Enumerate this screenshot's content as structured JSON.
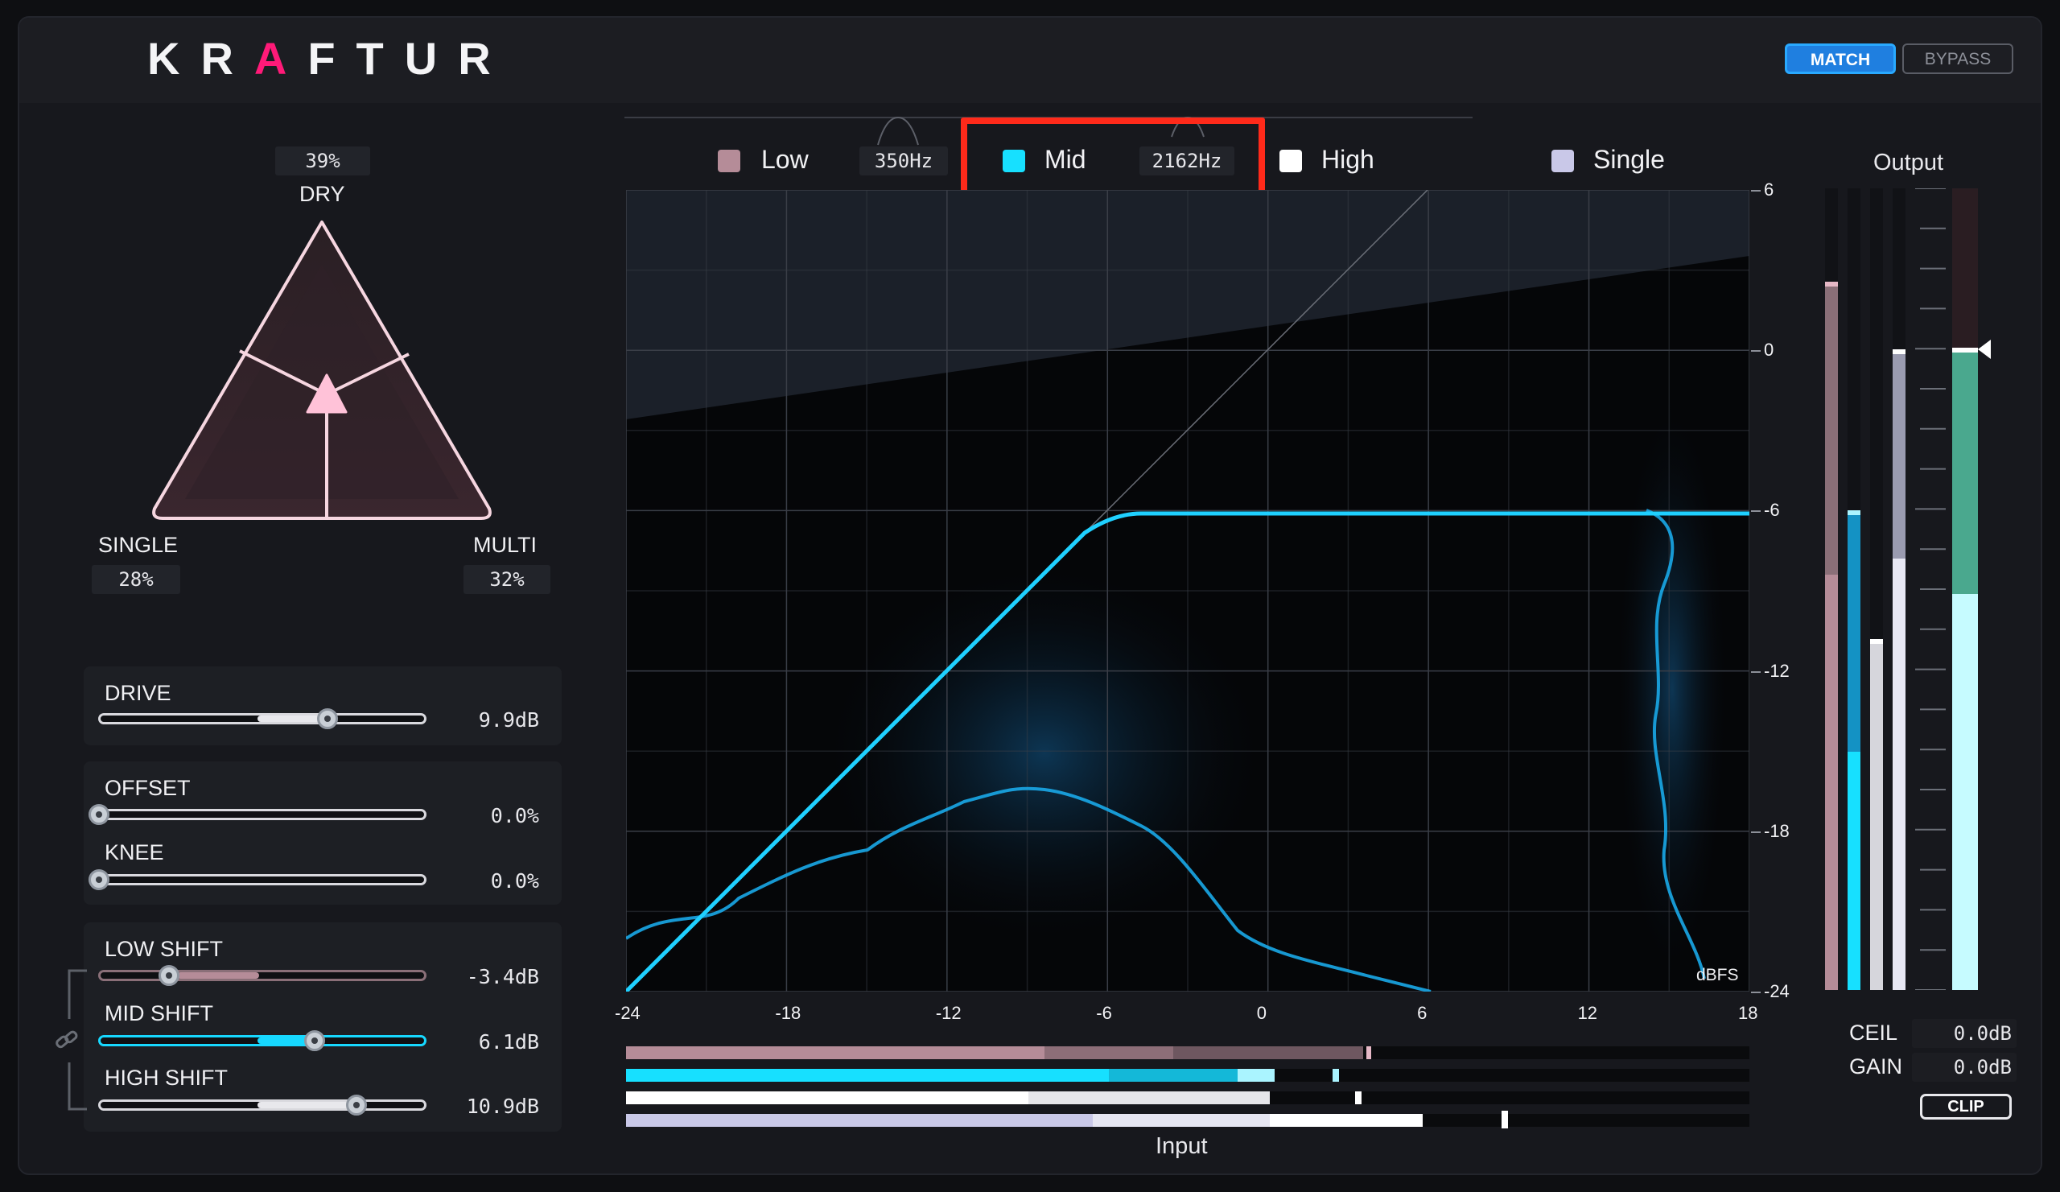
{
  "app": {
    "logo": "KRAFTUR",
    "logo_prefix": "KR",
    "logo_accent": "A",
    "logo_suffix": "FTUR",
    "accent_color": "#ff1a78"
  },
  "header": {
    "match_label": "MATCH",
    "bypass_label": "BYPASS"
  },
  "triangle": {
    "dry_label": "DRY",
    "dry_value": "39%",
    "single_label": "SINGLE",
    "single_value": "28%",
    "multi_label": "MULTI",
    "multi_value": "32%"
  },
  "controls": {
    "drive": {
      "label": "DRIVE",
      "value": "9.9dB",
      "position": 0.7
    },
    "offset": {
      "label": "OFFSET",
      "value": "0.0%",
      "position": 0.0
    },
    "knee": {
      "label": "KNEE",
      "value": "0.0%",
      "position": 0.0
    },
    "low_shift": {
      "label": "LOW SHIFT",
      "value": "-3.4dB",
      "position": 0.22
    },
    "mid_shift": {
      "label": "MID SHIFT",
      "value": "6.1dB",
      "position": 0.66
    },
    "high_shift": {
      "label": "HIGH SHIFT",
      "value": "10.9dB",
      "position": 0.79
    }
  },
  "bands": {
    "low": {
      "label": "Low",
      "freq": "350Hz",
      "color": "#b58c98"
    },
    "mid": {
      "label": "Mid",
      "freq": "2162Hz",
      "color": "#17e0ff"
    },
    "high": {
      "label": "High",
      "color": "#ffffff"
    },
    "single": {
      "label": "Single",
      "color": "#c9c8e8"
    }
  },
  "graph": {
    "x_label": "Input",
    "y_unit": "dBFS",
    "x_ticks": [
      "-24",
      "-18",
      "-12",
      "-6",
      "0",
      "6",
      "12",
      "18"
    ],
    "y_ticks": [
      "6",
      "0",
      "-6",
      "-12",
      "-18",
      "-24"
    ],
    "curve_color": "#1fd0ff",
    "ceiling_db": -6
  },
  "output": {
    "label": "Output",
    "ceil_label": "CEIL",
    "ceil_value": "0.0dB",
    "gain_label": "GAIN",
    "gain_value": "0.0dB",
    "clip_label": "CLIP"
  }
}
